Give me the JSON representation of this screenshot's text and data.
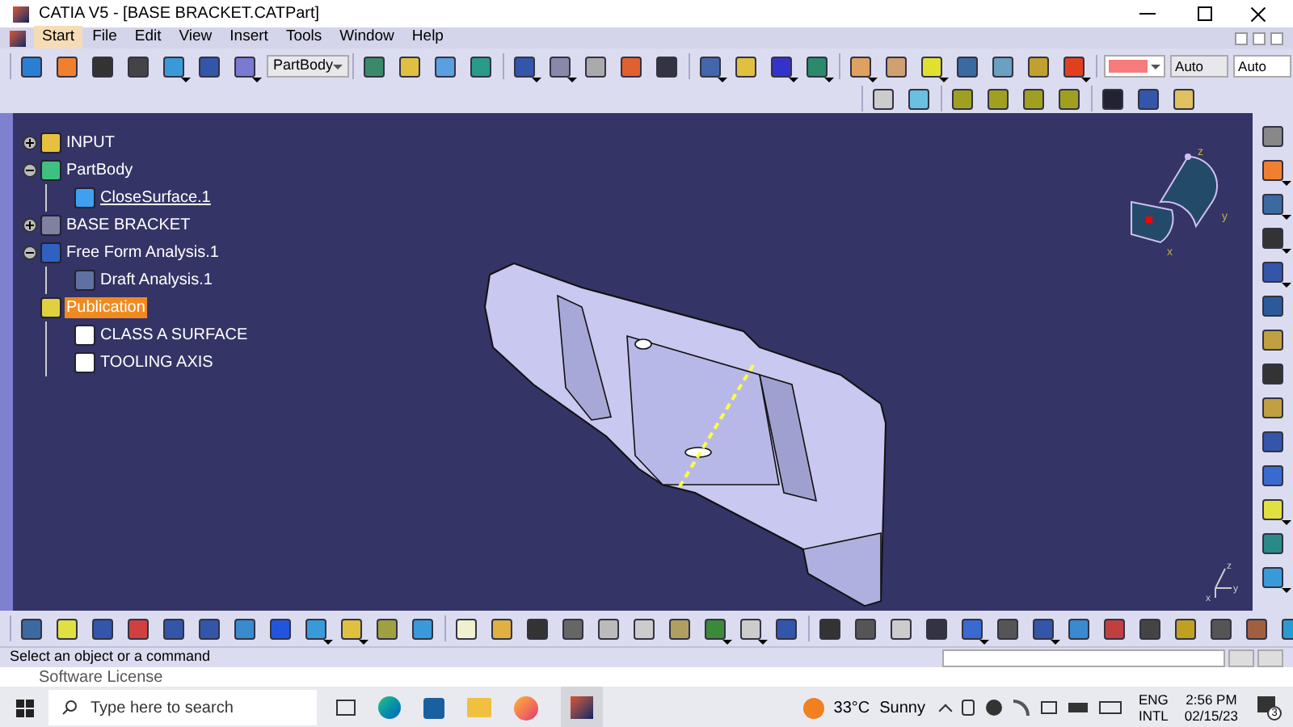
{
  "window": {
    "title": "CATIA V5 - [BASE BRACKET.CATPart]"
  },
  "menu": [
    {
      "label": "Start",
      "selected": true
    },
    {
      "label": "File",
      "selected": false
    },
    {
      "label": "Edit",
      "selected": false
    },
    {
      "label": "View",
      "selected": false
    },
    {
      "label": "Insert",
      "selected": false
    },
    {
      "label": "Tools",
      "selected": false
    },
    {
      "label": "Window",
      "selected": false
    },
    {
      "label": "Help",
      "selected": false
    }
  ],
  "toolbar": {
    "body_select": "PartBody",
    "color": "#f87b7b",
    "linetype": "Auto",
    "thickness": "Auto"
  },
  "tree": [
    {
      "label": "INPUT",
      "kind": "input",
      "expanded": false,
      "selected": false,
      "active": false
    },
    {
      "label": "PartBody",
      "kind": "body",
      "expanded": true,
      "selected": false,
      "active": false,
      "children": [
        {
          "label": "CloseSurface.1",
          "kind": "surface",
          "selected": false,
          "active": true
        }
      ]
    },
    {
      "label": "BASE BRACKET",
      "kind": "set",
      "expanded": false,
      "selected": false,
      "active": false
    },
    {
      "label": "Free Form Analysis.1",
      "kind": "analysis",
      "expanded": true,
      "selected": false,
      "active": false,
      "children": [
        {
          "label": "Draft Analysis.1",
          "kind": "draft",
          "selected": false,
          "active": false
        }
      ]
    },
    {
      "label": "Publication",
      "kind": "publication",
      "selected": true,
      "active": false,
      "children": [
        {
          "label": "CLASS A SURFACE",
          "kind": "pub",
          "selected": false,
          "active": false
        },
        {
          "label": "TOOLING AXIS",
          "kind": "pub",
          "selected": false,
          "active": false
        }
      ]
    }
  ],
  "compass": {
    "labels": [
      "z",
      "y",
      "x"
    ]
  },
  "axis": {
    "labels": [
      "z",
      "y",
      "x"
    ]
  },
  "status_bar": {
    "message": "Select an object or a command"
  },
  "background_window": {
    "title": "Software License"
  },
  "taskbar": {
    "search_placeholder": "Type here to search",
    "temperature": "33°C",
    "weather": "Sunny",
    "language": "ENG",
    "layout": "INTL",
    "time": "2:56 PM",
    "date": "02/15/23",
    "notifications": "3"
  }
}
